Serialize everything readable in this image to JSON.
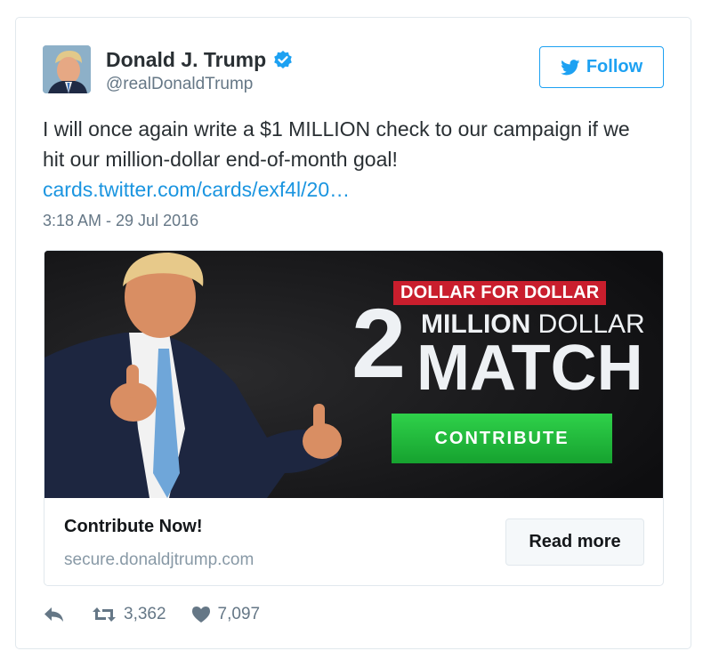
{
  "author": {
    "name": "Donald J. Trump",
    "handle": "@realDonaldTrump",
    "verified": true,
    "avatar_icon": "profile-photo"
  },
  "follow_button": {
    "label": "Follow",
    "icon": "twitter-bird-icon"
  },
  "tweet": {
    "text": "I will once again write a $1 MILLION check to our campaign if we hit our million-dollar end-of-month goal!",
    "link": "cards.twitter.com/cards/exf4l/20…",
    "timestamp": "3:18 AM - 29 Jul 2016"
  },
  "card": {
    "image": {
      "badge": "DOLLAR FOR DOLLAR",
      "big_number": "2",
      "line1_bold": "MILLION",
      "line1_rest": " DOLLAR",
      "line2": "MATCH",
      "button": "CONTRIBUTE"
    },
    "title": "Contribute Now!",
    "domain": "secure.donaldjtrump.com",
    "read_more": "Read more"
  },
  "actions": {
    "reply_icon": "reply-icon",
    "retweet_icon": "retweet-icon",
    "retweet_count": "3,362",
    "like_icon": "heart-icon",
    "like_count": "7,097"
  },
  "colors": {
    "accent": "#1da1f2",
    "link": "#1b95e0",
    "muted": "#657786",
    "badge_red": "#c91e2d",
    "contribute_green": "#22b83c"
  }
}
